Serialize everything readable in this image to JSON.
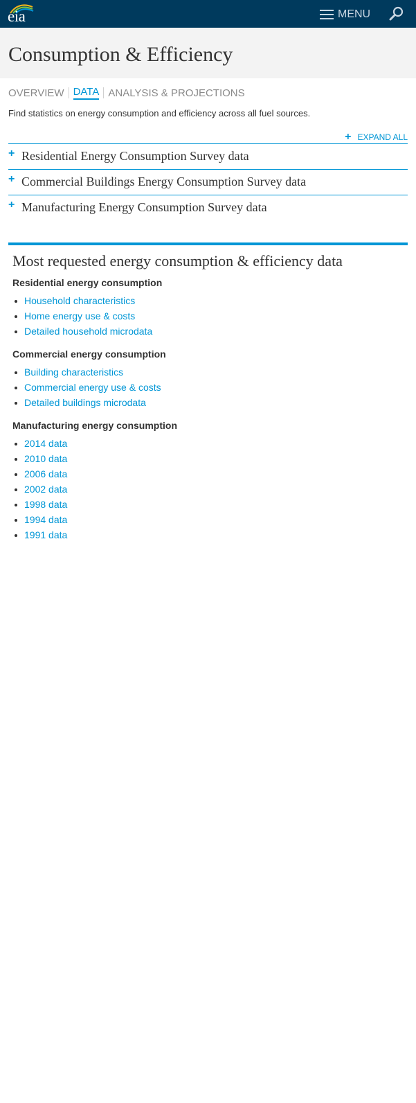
{
  "header": {
    "logo_text": "eia",
    "menu_label": "MENU",
    "icons": [
      "hamburger-icon",
      "search-icon"
    ],
    "background_color": "#003a5d"
  },
  "hero": {
    "title": "Consumption & Efficiency"
  },
  "tabs": [
    {
      "label": "OVERVIEW",
      "active": false
    },
    {
      "label": "DATA",
      "active": true
    },
    {
      "label": "ANALYSIS & PROJECTIONS",
      "active": false
    }
  ],
  "intro_text": "Find statistics on energy consumption and efficiency across all fuel sources.",
  "expand_all_label": "EXPAND ALL",
  "accordion": [
    {
      "title": "Residential Energy Consumption Survey data"
    },
    {
      "title": "Commercial Buildings Energy Consumption Survey data"
    },
    {
      "title": "Manufacturing Energy Consumption Survey data"
    }
  ],
  "most_requested": {
    "title": "Most requested energy consumption & efficiency data",
    "groups": [
      {
        "heading": "Residential energy consumption",
        "links": [
          "Household characteristics",
          "Home energy use & costs",
          "Detailed household microdata"
        ]
      },
      {
        "heading": "Commercial energy consumption",
        "links": [
          "Building characteristics",
          "Commercial energy use & costs",
          "Detailed buildings microdata"
        ]
      },
      {
        "heading": "Manufacturing energy consumption",
        "links": [
          "2014 data",
          "2010 data",
          "2006 data",
          "2002 data",
          "1998 data",
          "1994 data",
          "1991 data"
        ]
      }
    ]
  },
  "colors": {
    "accent": "#0096d6",
    "header_bg": "#003a5d",
    "hero_bg": "#f3f3f3"
  }
}
